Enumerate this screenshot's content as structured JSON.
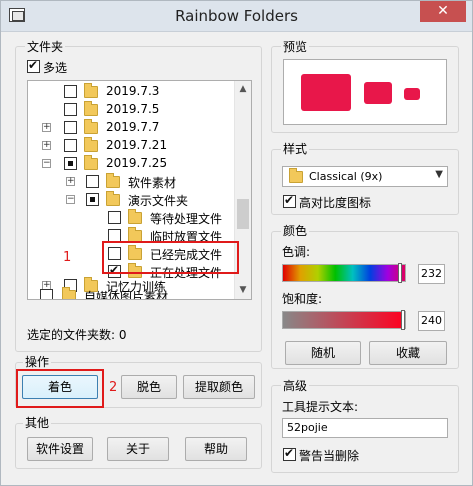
{
  "window": {
    "title": "Rainbow Folders",
    "close_glyph": "✕"
  },
  "folders_group": {
    "label": "文件夹",
    "multi_select_label": "多选",
    "selected_count_text": "选定的文件夹数: 0"
  },
  "tree_rows": [
    {
      "label": "2019.7.3"
    },
    {
      "label": "2019.7.5"
    },
    {
      "label": "2019.7.7"
    },
    {
      "label": "2019.7.21"
    },
    {
      "label": "2019.7.25"
    },
    {
      "label": "软件素材"
    },
    {
      "label": "演示文件夹"
    },
    {
      "label": "等待处理文件"
    },
    {
      "label": "临时放置文件"
    },
    {
      "label": "已经完成文件"
    },
    {
      "label": "正在处理文件"
    },
    {
      "label": "记忆力训练"
    },
    {
      "label": "自媒体图片素材"
    }
  ],
  "annotations": {
    "num1": "1",
    "num2": "2"
  },
  "operation_group": {
    "label": "操作",
    "colorize": "着色",
    "decolorize": "脱色",
    "extract_color": "提取颜色"
  },
  "other_group": {
    "label": "其他",
    "settings": "软件设置",
    "about": "关于",
    "help": "帮助"
  },
  "preview_group": {
    "label": "预览",
    "folder_color": "#e8174a"
  },
  "style_group": {
    "label": "样式",
    "selected_style": "Classical (9x)",
    "high_contrast_label": "高对比度图标"
  },
  "color_group": {
    "label": "颜色",
    "hue_label": "色调:",
    "hue_value": "232",
    "saturation_label": "饱和度:",
    "saturation_value": "240",
    "random_button": "随机",
    "favorites_button": "收藏"
  },
  "advanced_group": {
    "label": "高级",
    "tooltip_label": "工具提示文本:",
    "tooltip_value": "52pojie",
    "warn_delete_label": "警告当删除"
  }
}
